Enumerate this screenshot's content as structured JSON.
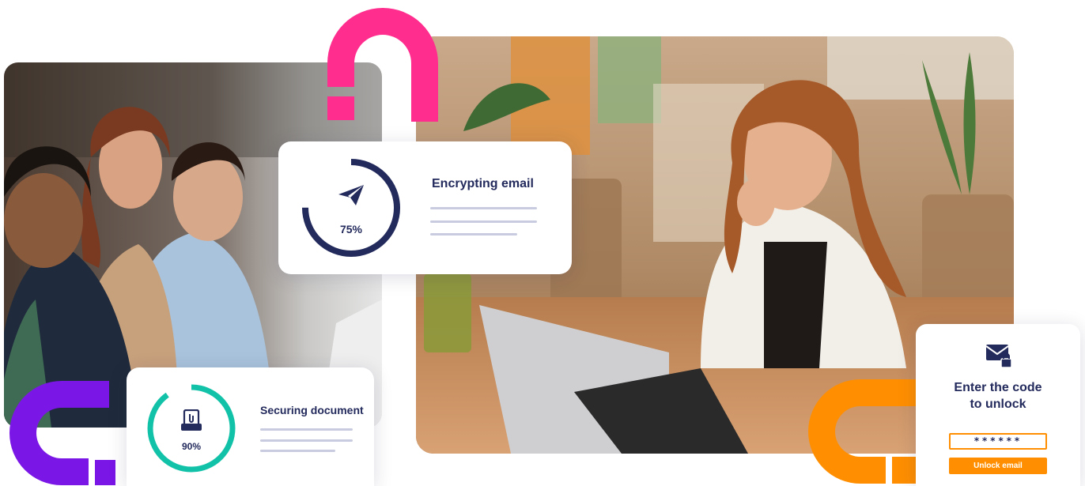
{
  "colors": {
    "navy": "#232a5c",
    "teal": "#12c2a8",
    "pink": "#ff2e8e",
    "purple": "#7a16e6",
    "orange": "#ff8f00",
    "skeleton_line": "#c9cbe0"
  },
  "photos": {
    "left": "group-at-laptop-photo",
    "right": "woman-at-laptop-photo"
  },
  "encrypt_card": {
    "title": "Encrypting email",
    "progress_label": "75%",
    "progress": 0.75,
    "icon": "paper-plane-icon"
  },
  "secure_card": {
    "title": "Securing document",
    "progress_label": "90%",
    "progress": 0.9,
    "icon": "document-clip-icon"
  },
  "unlock_card": {
    "icon": "locked-envelope-icon",
    "title_line1": "Enter the code",
    "title_line2": "to unlock",
    "code_value": "******",
    "button_label": "Unlock email"
  }
}
